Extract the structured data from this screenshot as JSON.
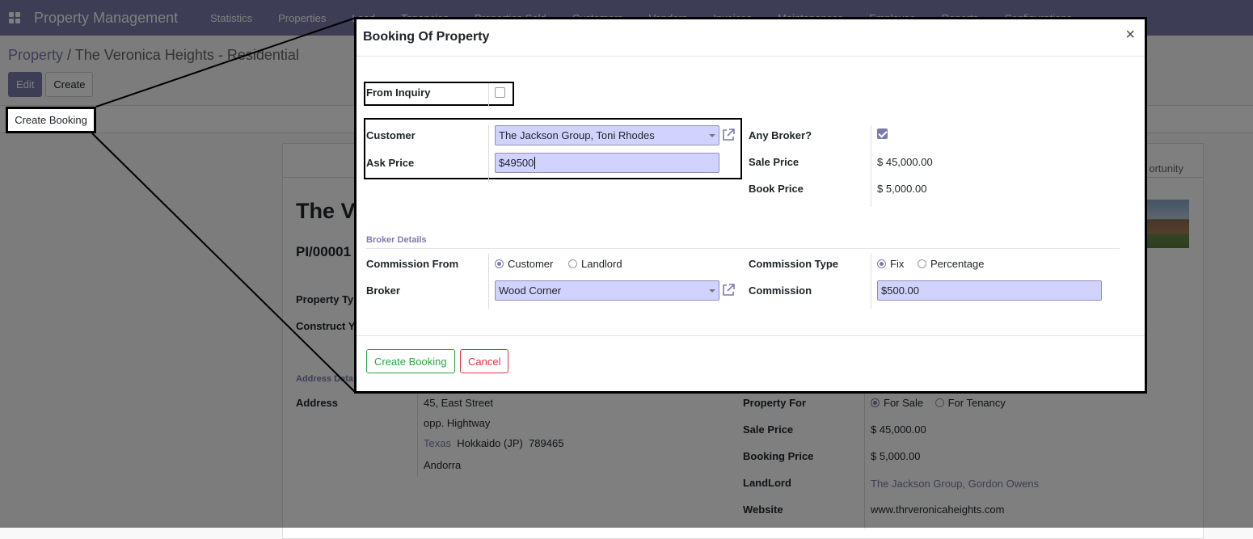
{
  "navbar": {
    "brand": "Property Management",
    "menu": [
      "Statistics",
      "Properties",
      "Lead",
      "Tenancies",
      "Properties Sold",
      "Customers",
      "Vendors",
      "Invoices",
      "Maintenances",
      "Employee",
      "Reports",
      "Configurations"
    ]
  },
  "breadcrumb": {
    "parent": "Property",
    "separator": "/",
    "current": "The Veronica Heights - Residential"
  },
  "control_panel": {
    "edit_label": "Edit",
    "create_label": "Create"
  },
  "statusbar": {
    "create_booking_label": "Create Booking"
  },
  "sheet": {
    "title_partial": "The Ve",
    "ref_partial": "PI/00001",
    "smart_button_partial": "ortunity",
    "property_type_label": "Property Ty",
    "construct_label": "Construct Y",
    "address_section": "Address Deta",
    "address_label": "Address",
    "address_lines": [
      "45, East Street",
      "opp. Hightway"
    ],
    "state": "Texas",
    "region": "Hokkaido (JP)",
    "zip": "789465",
    "country": "Andorra",
    "property_for_label": "Property For",
    "property_for_options": [
      "For Sale",
      "For Tenancy"
    ],
    "sale_price_label": "Sale Price",
    "sale_price": "$ 45,000.00",
    "booking_price_label": "Booking Price",
    "booking_price": "$ 5,000.00",
    "landlord_label": "LandLord",
    "landlord": "The Jackson Group, Gordon Owens",
    "website_label": "Website",
    "website": "www.thrveronicaheights.com"
  },
  "modal": {
    "title": "Booking Of Property",
    "close": "×",
    "from_inquiry_label": "From Inquiry",
    "from_inquiry_checked": false,
    "customer_label": "Customer",
    "customer_value": "The Jackson Group, Toni Rhodes",
    "ask_price_label": "Ask Price",
    "ask_price_value": "$49500",
    "any_broker_label": "Any Broker?",
    "any_broker_checked": true,
    "sale_price_label": "Sale Price",
    "sale_price_value": "$ 45,000.00",
    "book_price_label": "Book Price",
    "book_price_value": "$ 5,000.00",
    "broker_section": "Broker Details",
    "commission_from_label": "Commission From",
    "commission_from_options": [
      "Customer",
      "Landlord"
    ],
    "commission_from_selected": "Customer",
    "broker_label": "Broker",
    "broker_value": "Wood Corner",
    "commission_type_label": "Commission Type",
    "commission_type_options": [
      "Fix",
      "Percentage"
    ],
    "commission_type_selected": "Fix",
    "commission_label": "Commission",
    "commission_value": "$500.00",
    "create_booking_button": "Create Booking",
    "cancel_button": "Cancel"
  },
  "colors": {
    "brand": "#7c7bad",
    "field_bg": "#d2d2ff",
    "success": "#28a745",
    "danger": "#dc3545"
  }
}
